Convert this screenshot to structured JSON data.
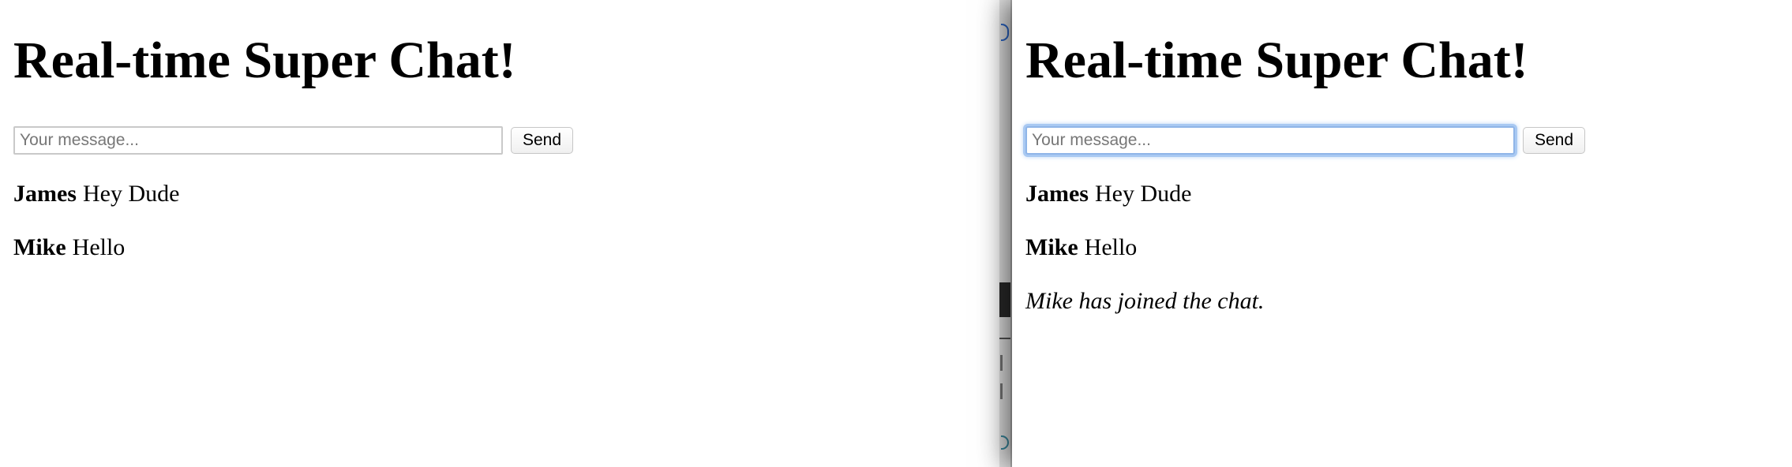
{
  "left_window": {
    "title": "Real-time Super Chat!",
    "input_placeholder": "Your message...",
    "input_value": "",
    "send_label": "Send",
    "messages": [
      {
        "author": "James",
        "text": "Hey Dude"
      },
      {
        "author": "Mike",
        "text": "Hello"
      }
    ]
  },
  "right_window": {
    "title": "Real-time Super Chat!",
    "input_placeholder": "Your message...",
    "input_value": "",
    "input_focused": true,
    "send_label": "Send",
    "messages": [
      {
        "author": "James",
        "text": "Hey Dude"
      },
      {
        "author": "Mike",
        "text": "Hello"
      }
    ],
    "system_message": "Mike has joined the chat."
  },
  "colors": {
    "focus_ring": "#a9c9f2",
    "input_border": "#c9c9c9",
    "window_shadow": "#000000"
  }
}
